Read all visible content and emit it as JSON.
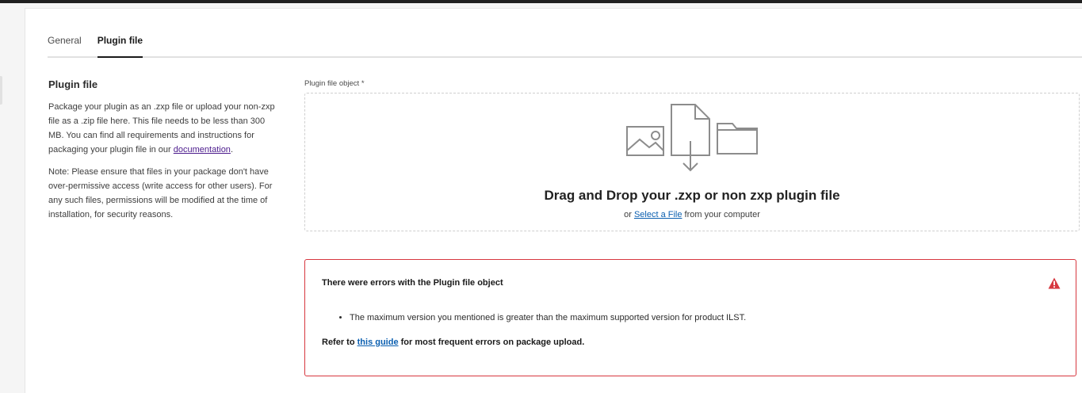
{
  "tabs": [
    {
      "label": "General"
    },
    {
      "label": "Plugin file"
    }
  ],
  "description": {
    "title": "Plugin file",
    "p1_before": "Package your plugin as an .zxp file or upload your non-zxp file as a .zip file here. This file needs to be less than 300 MB. You can find all requirements and instructions for packaging your plugin file in our ",
    "p1_link": "documentation",
    "p1_after": ".",
    "p2": "Note: Please ensure that files in your package don't have over-permissive access (write access for other users). For any such files, permissions will be modified at the time of installation, for security reasons."
  },
  "upload": {
    "label": "Plugin file object *",
    "title": "Drag and Drop your .zxp or non zxp plugin file",
    "sub_before": "or ",
    "sub_link": "Select a File",
    "sub_after": " from your computer"
  },
  "error": {
    "title": "There were errors with the Plugin file object",
    "items": [
      "The maximum version you mentioned is greater than the maximum supported version for product ILST."
    ],
    "refer_before": "Refer to ",
    "refer_link": "this guide",
    "refer_after": " for most frequent errors on package upload.",
    "color": "#d7373f"
  },
  "icons": {
    "illustration": "image-file-folder-icon",
    "error": "alert-triangle-icon"
  }
}
